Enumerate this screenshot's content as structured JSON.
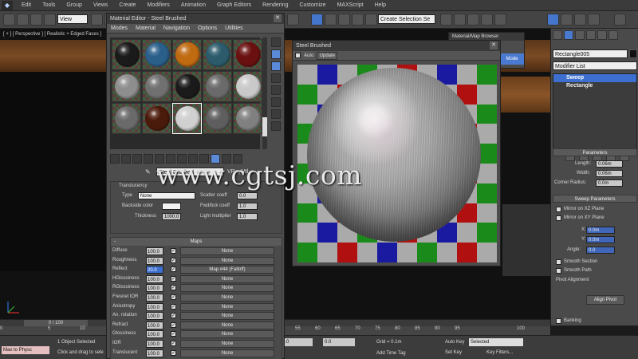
{
  "menu": {
    "items": [
      "Edit",
      "Tools",
      "Group",
      "Views",
      "Create",
      "Modifiers",
      "Animation",
      "Graph Editors",
      "Rendering",
      "Customize",
      "MAXScript",
      "Help"
    ]
  },
  "toolbar": {
    "view_dropdown": "View",
    "selection_set": "Create Selection Se"
  },
  "viewport": {
    "label": "[ + ] [ Perspective ] [ Realistic + Edged Faces ]",
    "watermark": "www.cgtsj.com"
  },
  "material_editor": {
    "title": "Material Editor - Steel Brushed",
    "menu": [
      "Modes",
      "Material",
      "Navigation",
      "Options",
      "Utilities"
    ],
    "slot_colors": [
      "#1a1a1a",
      "#2a5f8a",
      "#c06a12",
      "#2c5c6c",
      "#6a1010",
      "#8e8e8e",
      "#707070",
      "#1a1a1a",
      "#6a6a6a",
      "#c9c9c9",
      "#6a6a6a",
      "#4a1a0a",
      "#d0d0d0",
      "#5e5e5e",
      "#808080"
    ],
    "selected_slot": 12,
    "material_name": "Steel Brushed",
    "material_type": "VRayMtl",
    "translucency": {
      "header": "Translucency",
      "type_label": "Type",
      "type_value": "None",
      "backside_label": "Backside color",
      "thickness_label": "Thickness",
      "thickness_value": "1000.0",
      "scatter_label": "Scatter coeff",
      "scatter_value": "0.0",
      "fwdbck_label": "Fwd/bck coeff",
      "fwdbck_value": "1.0",
      "light_label": "Light multiplier",
      "light_value": "1.0"
    },
    "maps": {
      "header": "Maps",
      "rows": [
        {
          "name": "Diffuse",
          "value": "100.0",
          "map": "None",
          "highlight": false
        },
        {
          "name": "Roughness",
          "value": "100.0",
          "map": "None",
          "highlight": false
        },
        {
          "name": "Reflect",
          "value": "20.0",
          "map": "Map #44 (Falloff)",
          "highlight": true
        },
        {
          "name": "HGlossiness",
          "value": "100.0",
          "map": "None",
          "highlight": false
        },
        {
          "name": "RGlossiness",
          "value": "100.0",
          "map": "None",
          "highlight": false
        },
        {
          "name": "Fresnel IOR",
          "value": "100.0",
          "map": "None",
          "highlight": false
        },
        {
          "name": "Anisotropy",
          "value": "100.0",
          "map": "None",
          "highlight": false
        },
        {
          "name": "An. rotation",
          "value": "100.0",
          "map": "None",
          "highlight": false
        },
        {
          "name": "Refract",
          "value": "100.0",
          "map": "None",
          "highlight": false
        },
        {
          "name": "Glossiness",
          "value": "100.0",
          "map": "None",
          "highlight": false
        },
        {
          "name": "IOR",
          "value": "100.0",
          "map": "None",
          "highlight": false
        },
        {
          "name": "Translucent",
          "value": "100.0",
          "map": "None",
          "highlight": false
        }
      ]
    }
  },
  "preview": {
    "title": "Steel Brushed",
    "auto_label": "Auto",
    "update_label": "Update",
    "checker_colors": [
      "#aaaaaa",
      "#1a8a1a",
      "#1a1aa0",
      "#b01010"
    ]
  },
  "subwindow": {
    "title": "Material/Map Browser",
    "mode_label": "Mode"
  },
  "command_panel": {
    "object_name": "Rectangle005",
    "modifier_list": "Modifier List",
    "stack": [
      "Sweep",
      "Rectangle"
    ],
    "parameters": {
      "header": "Parameters",
      "length_label": "Length:",
      "length_value": "0.06m",
      "width_label": "Width:",
      "width_value": "0.06m",
      "corner_label": "Corner Radius:",
      "corner_value": "0.0m"
    },
    "sweep": {
      "header": "Sweep Parameters",
      "mirror_xz": "Mirror on XZ Plane",
      "mirror_xy": "Mirror on XY Plane",
      "x_label": "X:",
      "x_value": "0.0m",
      "y_label": "Y:",
      "y_value": "0.0m",
      "angle_label": "Angle:",
      "angle_value": "0.0",
      "smooth_section": "Smooth Section",
      "smooth_path": "Smooth Path",
      "pivot_label": "Pivot Alignment",
      "align_pivot": "Align Pivot",
      "banking": "Banking"
    }
  },
  "timeline": {
    "frame_readout": "0 / 100",
    "ticks": [
      "0",
      "5",
      "10",
      "55",
      "60",
      "65",
      "70",
      "75",
      "80",
      "85",
      "90",
      "95",
      "100"
    ]
  },
  "status": {
    "maxscript": "Max to Physc",
    "selected": "1 Object Selected",
    "prompt": "Click and drag to select",
    "x": "0.0",
    "y": "0.0",
    "grid": "Grid = 0.1m",
    "autokey": "Auto Key",
    "selected_dd": "Selected",
    "setkey": "Set Key",
    "keyfilters": "Key Filters...",
    "addtime": "Add Time Tag"
  }
}
